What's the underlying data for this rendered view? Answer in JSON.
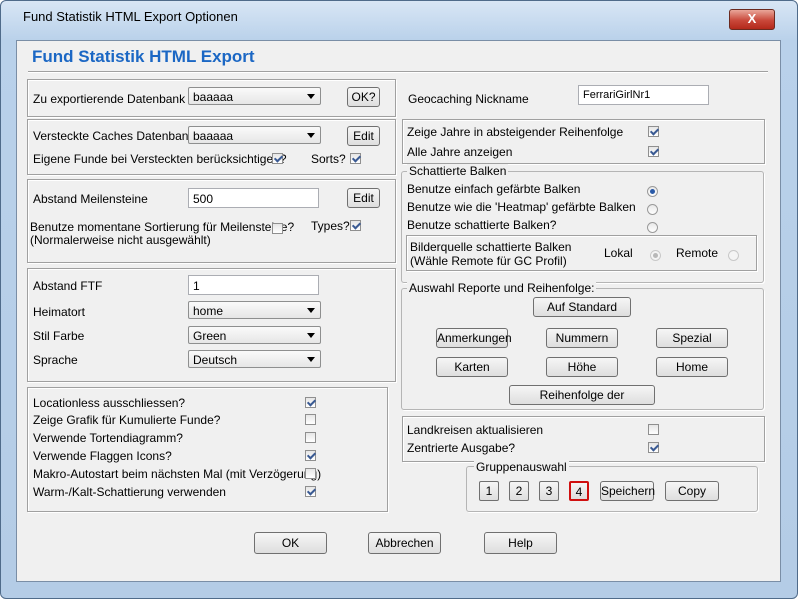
{
  "window": {
    "title": "Fund Statistik HTML Export Optionen",
    "close": "X"
  },
  "heading": "Fund Statistik HTML Export",
  "db": {
    "label": "Zu exportierende Datenbank",
    "value": "baaaaa",
    "ok": "OK?"
  },
  "nick": {
    "label": "Geocaching Nickname",
    "value": "FerrariGirlNr1"
  },
  "hidden": {
    "label": "Versteckte Caches Datenbank",
    "value": "baaaaa",
    "edit": "Edit",
    "own_label": "Eigene Funde bei Versteckten berücksichtigen?",
    "own_checked": true,
    "sorts_label": "Sorts?",
    "sorts_checked": true
  },
  "milestone": {
    "label": "Abstand Meilensteine",
    "value": "500",
    "edit": "Edit",
    "sort_label": "Benutze momentane Sortierung für Meilensteine?",
    "sort_note": "(Normalerweise nicht ausgewählt)",
    "sort_checked": false,
    "types_label": "Types?",
    "types_checked": true
  },
  "ftf": {
    "label": "Abstand FTF",
    "value": "1"
  },
  "home": {
    "label": "Heimatort",
    "value": "home"
  },
  "color": {
    "label": "Stil Farbe",
    "value": "Green"
  },
  "lang": {
    "label": "Sprache",
    "value": "Deutsch"
  },
  "options": [
    {
      "label": "Locationless ausschliessen?",
      "checked": true
    },
    {
      "label": "Zeige Grafik für Kumulierte Funde?",
      "checked": false
    },
    {
      "label": "Verwende Tortendiagramm?",
      "checked": false
    },
    {
      "label": "Verwende Flaggen Icons?",
      "checked": true
    },
    {
      "label": "Makro-Autostart beim nächsten Mal (mit Verzögerung)",
      "checked": false
    },
    {
      "label": "Warm-/Kalt-Schattierung verwenden",
      "checked": true
    }
  ],
  "years": {
    "desc_label": "Zeige Jahre in absteigender Reihenfolge",
    "desc_checked": true,
    "all_label": "Alle Jahre anzeigen",
    "all_checked": true
  },
  "shaded": {
    "legend": "Schattierte Balken",
    "opt1": "Benutze einfach gefärbte Balken",
    "opt2": "Benutze wie die 'Heatmap' gefärbte Balken",
    "opt3": "Benutze schattierte Balken?",
    "selected": 1,
    "src_label": "Bilderquelle schattierte Balken",
    "src_note": "(Wähle Remote für GC Profil)",
    "local": "Lokal",
    "remote": "Remote"
  },
  "reports": {
    "legend": "Auswahl Reporte und Reihenfolge:",
    "standard": "Auf Standard",
    "b1": "Anmerkungen",
    "b2": "Nummern",
    "b3": "Spezial",
    "b4": "Karten",
    "b5": "Höhe",
    "b6": "Home",
    "order": "Reihenfolge der"
  },
  "land": {
    "update_label": "Landkreisen aktualisieren",
    "update_checked": false,
    "center_label": "Zentrierte Ausgabe?",
    "center_checked": true
  },
  "groups": {
    "legend": "Gruppenauswahl",
    "g1": "1",
    "g2": "2",
    "g3": "3",
    "g4": "4",
    "selected": "4",
    "save": "Speichern",
    "copy": "Copy"
  },
  "footer": {
    "ok": "OK",
    "cancel": "Abbrechen",
    "help": "Help"
  }
}
